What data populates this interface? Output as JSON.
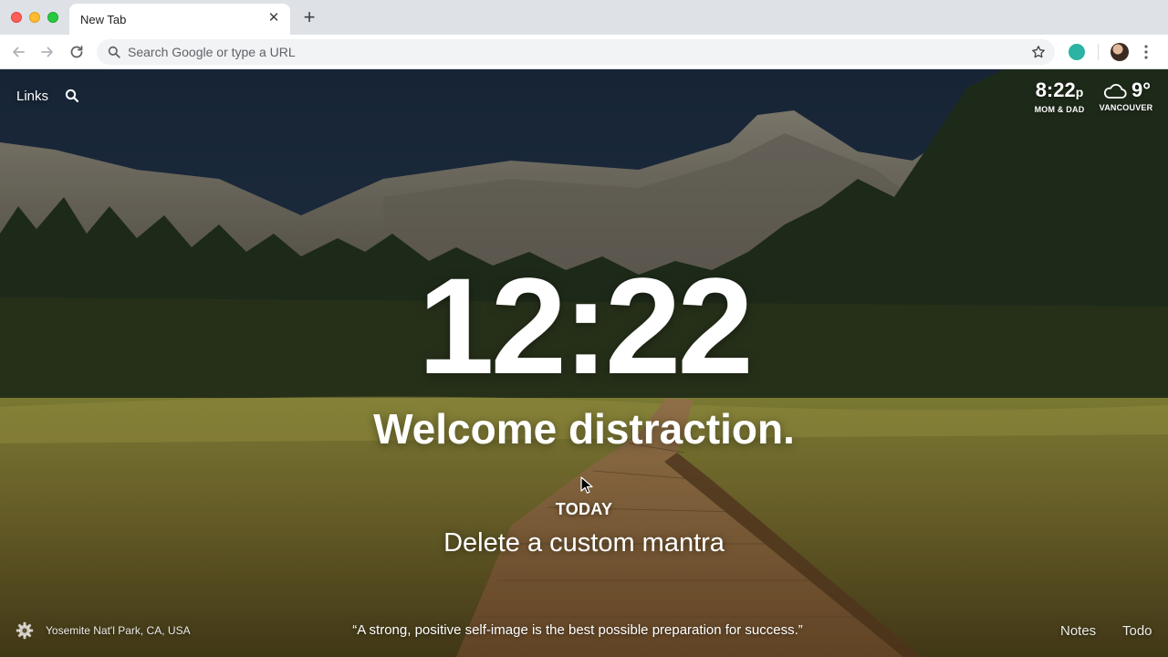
{
  "browser": {
    "tab_title": "New Tab",
    "tab_close": "✕",
    "new_tab": "+",
    "omnibox_placeholder": "Search Google or type a URL",
    "extension_color": "#2bb3a3"
  },
  "top_left": {
    "links_label": "Links"
  },
  "world_clock": {
    "time": "8:22",
    "ampm": "p",
    "label": "MOM & DAD"
  },
  "weather": {
    "temperature": "9°",
    "location": "VANCOUVER",
    "icon": "cloud-icon"
  },
  "clock": {
    "time": "12:22"
  },
  "greeting": "Welcome distraction.",
  "focus": {
    "label": "TODAY",
    "text": "Delete a custom mantra"
  },
  "bottom": {
    "photo_location": "Yosemite Nat'l Park, CA, USA",
    "quote": "“A strong, positive self-image is the best possible preparation for success.”",
    "notes_label": "Notes",
    "todo_label": "Todo"
  }
}
